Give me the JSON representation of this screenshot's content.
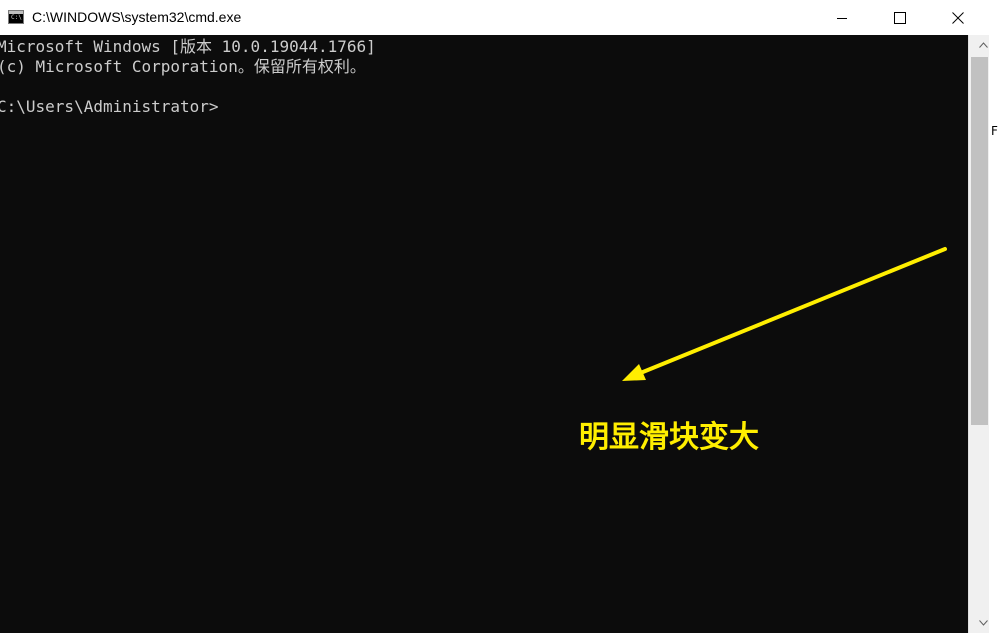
{
  "window": {
    "title": "C:\\WINDOWS\\system32\\cmd.exe",
    "icon": "cmd-icon",
    "controls": {
      "minimize_icon": "minimize-icon",
      "maximize_icon": "maximize-icon",
      "close_icon": "close-icon"
    }
  },
  "console": {
    "lines": [
      "Microsoft Windows [版本 10.0.19044.1766]",
      "(c) Microsoft Corporation。保留所有权利。",
      "",
      "C:\\Users\\Administrator>"
    ],
    "background": "#0c0c0c",
    "foreground": "#cccccc"
  },
  "scrollbar": {
    "up_icon": "scroll-up-arrow-icon",
    "down_icon": "scroll-down-arrow-icon"
  },
  "annotation": {
    "text": "明显滑块变大",
    "color": "#ffee00",
    "arrow_icon": "arrow-icon"
  },
  "edge": {
    "glyph": "F"
  }
}
